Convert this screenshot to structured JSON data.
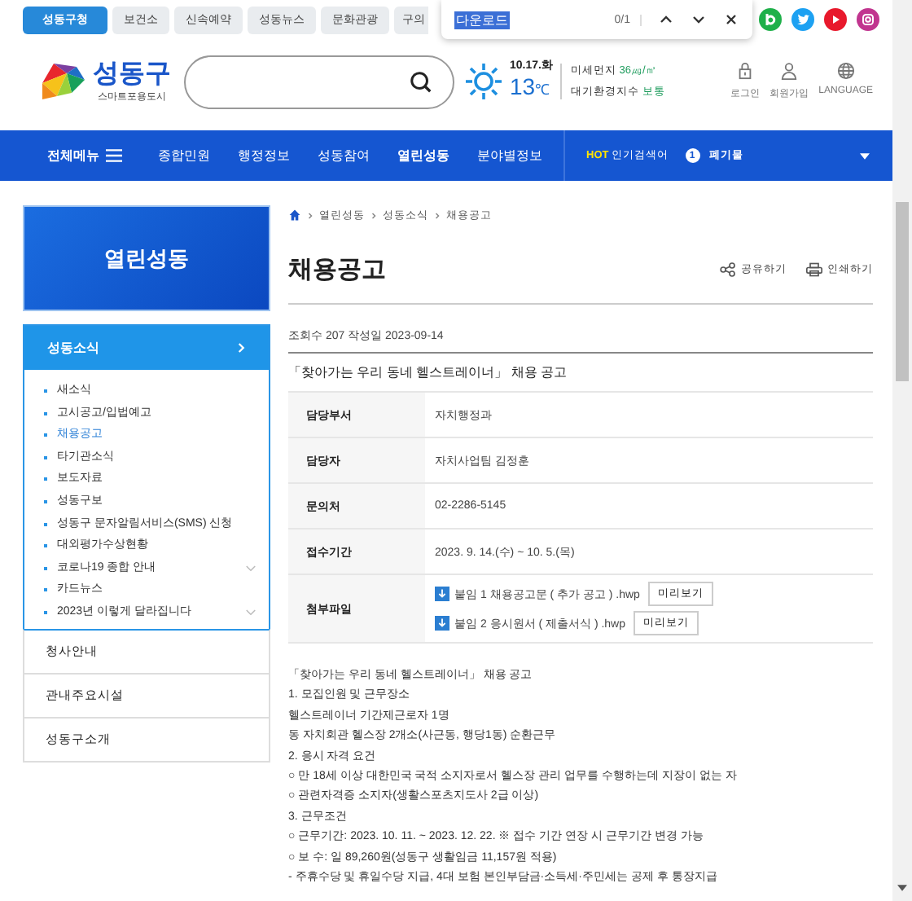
{
  "top_tabs": [
    {
      "label": "성동구청",
      "selected": true
    },
    {
      "label": "보건소",
      "selected": false
    },
    {
      "label": "신속예약",
      "selected": false
    },
    {
      "label": "성동뉴스",
      "selected": false
    },
    {
      "label": "문화관광",
      "selected": false
    },
    {
      "label": "구의",
      "selected": false
    }
  ],
  "find_bar": {
    "query": "다운로드",
    "count": "0/1"
  },
  "logo": {
    "name": "성동구",
    "tagline": "스마트포용도시"
  },
  "weather": {
    "date": "10.17.화",
    "temperature": "13",
    "unit": "℃",
    "dust_label": "미세먼지",
    "dust_value": "36㎍/㎥",
    "air_label": "대기환경지수",
    "air_value": "보통"
  },
  "user_links": [
    {
      "kind": "lock",
      "label": "로그인"
    },
    {
      "kind": "person",
      "label": "회원가입"
    },
    {
      "kind": "globe",
      "label": "LANGUAGE"
    }
  ],
  "nav": {
    "menu_label": "전체메뉴",
    "items": [
      {
        "label": "종합민원",
        "selected": false
      },
      {
        "label": "행정정보",
        "selected": false
      },
      {
        "label": "성동참여",
        "selected": false
      },
      {
        "label": "열린성동",
        "selected": true
      },
      {
        "label": "분야별정보",
        "selected": false
      }
    ],
    "hot_label": "HOT",
    "hot_text": "인기검색어",
    "hot_rank": "1",
    "hot_keyword": "폐기물"
  },
  "sidebar": {
    "title": "열린성동",
    "section": "성동소식",
    "items": [
      {
        "label": "새소식",
        "selected": false,
        "has_submenu": false
      },
      {
        "label": "고시공고/입법예고",
        "selected": false,
        "has_submenu": false
      },
      {
        "label": "채용공고",
        "selected": true,
        "has_submenu": false
      },
      {
        "label": "타기관소식",
        "selected": false,
        "has_submenu": false
      },
      {
        "label": "보도자료",
        "selected": false,
        "has_submenu": false
      },
      {
        "label": "성동구보",
        "selected": false,
        "has_submenu": false
      },
      {
        "label": "성동구 문자알림서비스(SMS) 신청",
        "selected": false,
        "has_submenu": false
      },
      {
        "label": "대외평가수상현황",
        "selected": false,
        "has_submenu": false
      },
      {
        "label": "코로나19 종합 안내",
        "selected": false,
        "has_submenu": true
      },
      {
        "label": "카드뉴스",
        "selected": false,
        "has_submenu": false
      },
      {
        "label": "2023년 이렇게 달라집니다",
        "selected": false,
        "has_submenu": true
      }
    ],
    "links": [
      "청사안내",
      "관내주요시설",
      "성동구소개"
    ]
  },
  "breadcrumb": [
    "열린성동",
    "성동소식",
    "채용공고"
  ],
  "page_title": "채용공고",
  "actions": [
    {
      "kind": "share",
      "label": "공유하기"
    },
    {
      "kind": "print",
      "label": "인쇄하기"
    }
  ],
  "meta": "조회수 207 작성일 2023-09-14",
  "post_title": "「찾아가는 우리 동네 헬스트레이너」 채용 공고",
  "info_rows": [
    {
      "label": "담당부서",
      "value": "자치행정과"
    },
    {
      "label": "담당자",
      "value": "자치사업팀 김정훈"
    },
    {
      "label": "문의처",
      "value": "02-2286-5145"
    },
    {
      "label": "접수기간",
      "value": "2023. 9. 14.(수) ~ 10. 5.(목)"
    }
  ],
  "attachments": {
    "label": "첨부파일",
    "files": [
      {
        "name": "붙임 1 채용공고문 ( 추가 공고 ) .hwp",
        "button": "미리보기"
      },
      {
        "name": "붙임 2 응시원서 ( 제출서식 ) .hwp",
        "button": "미리보기"
      }
    ]
  },
  "body": [
    "「찾아가는 우리 동네 헬스트레이너」 채용 공고",
    "1. 모집인원 및 근무장소",
    "헬스트레이너 기간제근로자 1명",
    "동 자치회관 헬스장 2개소(사근동, 행당1동) 순환근무",
    "2. 응시 자격 요건",
    "○ 만 18세 이상 대한민국 국적 소지자로서 헬스장 관리 업무를 수행하는데 지장이 없는 자",
    "○ 관련자격증 소지자(생활스포츠지도사 2급 이상)",
    "3. 근무조건",
    "○ 근무기간: 2023. 10. 11. ~ 2023. 12. 22. ※ 접수 기간 연장 시 근무기간 변경 가능",
    "○ 보 수: 일 89,260원(성동구 생활임금 11,157원 적용)",
    "- 주휴수당 및 휴일수당 지급, 4대 보험 본인부담금·소득세·주민세는 공제 후 통장지급"
  ]
}
